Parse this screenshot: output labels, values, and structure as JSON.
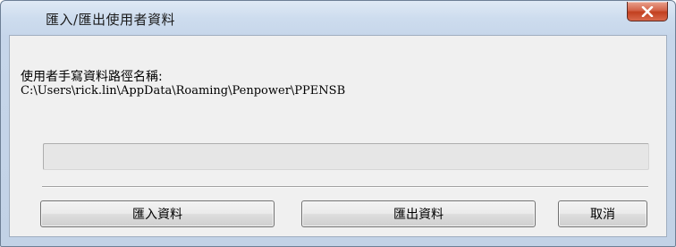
{
  "window": {
    "title": "匯入/匯出使用者資料"
  },
  "content": {
    "path_label": "使用者手寫資料路徑名稱:",
    "path_value": "C:\\Users\\rick.lin\\AppData\\Roaming\\Penpower\\PPENSB"
  },
  "progress": {
    "value": 0
  },
  "buttons": {
    "import_label": "匯入資料",
    "export_label": "匯出資料",
    "cancel_label": "取消"
  },
  "icons": {
    "close": "close-icon"
  },
  "colors": {
    "close_button": "#c2401f",
    "dialog_background": "#f0f0f0",
    "frame": "#c6d6ea"
  }
}
